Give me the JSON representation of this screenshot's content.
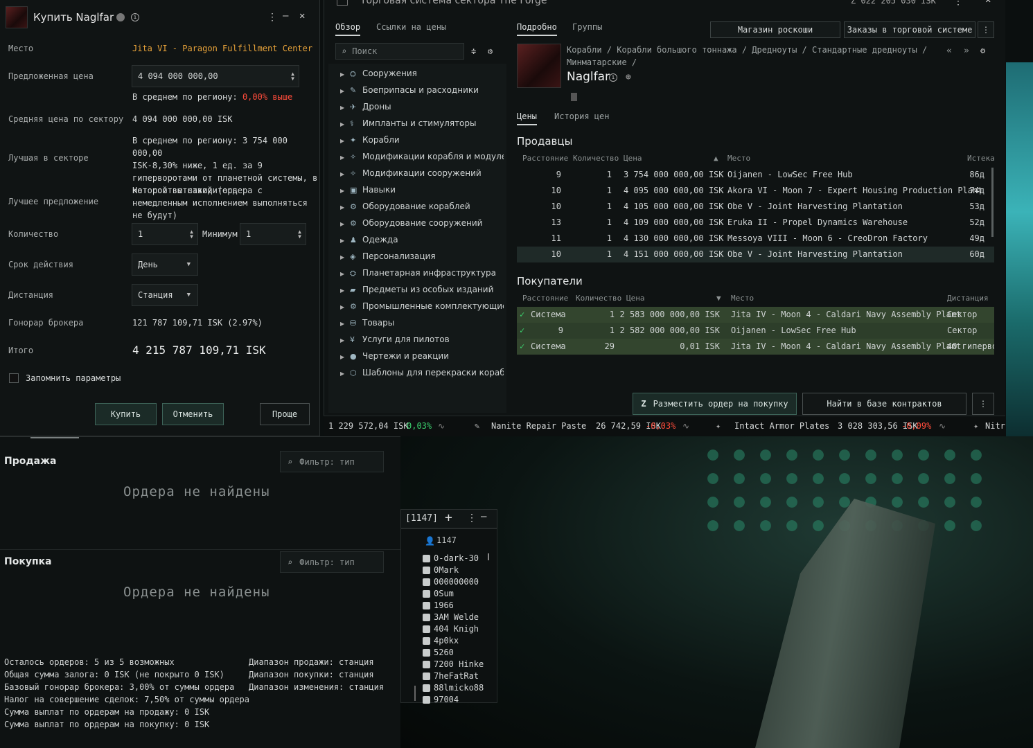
{
  "buy_window": {
    "title": "Купить Naglfar",
    "location_label": "Место",
    "location_value": "Jita VI - Paragon Fulfillment Center",
    "offered_price_label": "Предложенная цена",
    "offered_price_value": "4 094 000 000,00",
    "region_avg_prefix": "В среднем по региону:",
    "region_avg_pct": "0,00% выше",
    "sector_avg_label": "Средняя цена по сектору",
    "sector_avg_value": "4 094 000 000,00 ISK",
    "best_in_sector_label": "Лучшая в секторе",
    "best_in_sector_lines": [
      "В среднем по региону: 3 754 000 000,00",
      "ISK-8,30% ниже, 1 ед. за 9",
      "гиперворотами от планетной системы, в",
      "которой вы находитесь"
    ],
    "best_offer_label": "Лучшее предложение",
    "best_offer_lines": [
      "Нет соответствий (ордера с",
      "немедленным исполнением выполняться",
      "не будут)"
    ],
    "quantity_label": "Количество",
    "quantity_value": "1",
    "minimum_label": "Минимум",
    "minimum_value": "1",
    "duration_label": "Срок действия",
    "duration_value": "День",
    "range_label": "Дистанция",
    "range_value": "Станция",
    "broker_fee_label": "Гонорар брокера",
    "broker_fee_value": "121 787 109,71 ISK (2.97%)",
    "total_label": "Итого",
    "total_value": "4 215 787 109,71 ISK",
    "remember_label": "Запомнить параметры",
    "buy_button": "Купить",
    "cancel_button": "Отменить",
    "simple_button": "Проще"
  },
  "market": {
    "window_title": "Торговая система сектора The Forge",
    "wallet": "Z 022 205 030 ISK",
    "left_tabs": [
      "Обзор",
      "Ссылки на цены"
    ],
    "search_placeholder": "Поиск",
    "tree": [
      "Сооружения",
      "Боеприпасы и расходники",
      "Дроны",
      "Импланты и стимуляторы",
      "Корабли",
      "Модификации корабля и модулей",
      "Модификации сооружений",
      "Навыки",
      "Оборудование кораблей",
      "Оборудование сооружений",
      "Одежда",
      "Персонализация",
      "Планетарная инфраструктура",
      "Предметы из особых изданий",
      "Промышленные комплектующие",
      "Товары",
      "Услуги для пилотов",
      "Чертежи и реакции",
      "Шаблоны для перекраски кораблей"
    ],
    "right_tabs": [
      "Подробно",
      "Группы"
    ],
    "luxury_button": "Магазин роскоши",
    "system_orders_button": "Заказы в торговой системе",
    "breadcrumb_line1": "Корабли / Корабли большого тоннажа / Дредноуты / Стандартные дредноуты /",
    "breadcrumb_line2": "Минматарские /",
    "item_name": "Naglfar",
    "sub_tabs": [
      "Цены",
      "История цен"
    ],
    "sellers_title": "Продавцы",
    "sellers_columns": [
      "Расстояние",
      "Количество",
      "Цена",
      "Место",
      "Истека"
    ],
    "sellers": [
      {
        "dist": "9",
        "qty": "1",
        "price": "3 754 000 000,00 ISK",
        "loc": "Oijanen - LowSec Free Hub",
        "exp": "86д"
      },
      {
        "dist": "10",
        "qty": "1",
        "price": "4 095 000 000,00 ISK",
        "loc": "Akora VI - Moon 7 - Expert Housing Production Plant",
        "exp": "74д"
      },
      {
        "dist": "10",
        "qty": "1",
        "price": "4 105 000 000,00 ISK",
        "loc": "Obe V - Joint Harvesting Plantation",
        "exp": "53д"
      },
      {
        "dist": "13",
        "qty": "1",
        "price": "4 109 000 000,00 ISK",
        "loc": "Eruka II - Propel Dynamics Warehouse",
        "exp": "52д"
      },
      {
        "dist": "11",
        "qty": "1",
        "price": "4 130 000 000,00 ISK",
        "loc": "Messoya VIII - Moon 6 - CreoDron Factory",
        "exp": "49д"
      },
      {
        "dist": "10",
        "qty": "1",
        "price": "4 151 000 000,00 ISK",
        "loc": "Obe V - Joint Harvesting Plantation",
        "exp": "60д"
      }
    ],
    "buyers_title": "Покупатели",
    "buyers_columns": [
      "Расстояние",
      "Количество",
      "Цена",
      "Место",
      "Дистанция"
    ],
    "buyers": [
      {
        "dist": "Система",
        "qty": "1",
        "price": "2 583 000 000,00 ISK",
        "loc": "Jita IV - Moon 4 - Caldari Navy Assembly Plant",
        "range": "Сектор"
      },
      {
        "dist": "9",
        "qty": "1",
        "price": "2 582 000 000,00 ISK",
        "loc": "Oijanen - LowSec Free Hub",
        "range": "Сектор"
      },
      {
        "dist": "Система",
        "qty": "29",
        "price": "0,01 ISK",
        "loc": "Jita IV - Moon 4 - Caldari Navy Assembly Plant",
        "range": "40 гиперво"
      }
    ],
    "place_buy_button": "Разместить ордер на покупку",
    "find_contracts_button": "Найти в базе контрактов",
    "ticker": [
      {
        "name": "",
        "price": "1 229 572,04 ISK",
        "change": "0,03%",
        "dir": "up"
      },
      {
        "name": "Nanite Repair Paste",
        "price": "26 742,59 ISK",
        "change": "-0,03%",
        "dir": "down"
      },
      {
        "name": "Intact Armor Plates",
        "price": "3 028 303,56 ISK",
        "change": "-0,09%",
        "dir": "down"
      },
      {
        "name": "Nitr",
        "price": "",
        "change": "",
        "dir": ""
      }
    ]
  },
  "orders": {
    "sell_title": "Продажа",
    "buy_title": "Покупка",
    "filter_placeholder": "Фильтр: тип",
    "empty_msg": "Ордера не найдены",
    "info_left": [
      "Осталось ордеров: 5 из 5 возможных",
      "Общая сумма залога: 0 ISK (не покрыто 0 ISK)",
      "Базовый гонорар брокера: 3,00% от суммы ордера",
      "Налог на совершение сделок: 7,50% от суммы ордера",
      "Сумма выплат по ордерам на продажу: 0 ISK",
      "Сумма выплат по ордерам на покупку: 0 ISK"
    ],
    "info_right": [
      "Диапазон продажи: станция",
      "Диапазон покупки: станция",
      "Диапазон изменения: станция"
    ]
  },
  "chat": {
    "count_badge": "[1147]",
    "member_count": "1147",
    "members": [
      "0-dark-30",
      "0Mark",
      "000000000",
      "0Sum",
      "1966",
      "3AM Welde",
      "404 Knigh",
      "4p0kx",
      "5260",
      "7200 Hinke",
      "7heFatRat",
      "88lmicko88",
      "97004"
    ]
  },
  "colors": {
    "accent_orange": "#e8a33a",
    "negative_red": "#ff4c3b",
    "positive_green": "#3bd16e",
    "buy_row_green": "#33452e"
  }
}
